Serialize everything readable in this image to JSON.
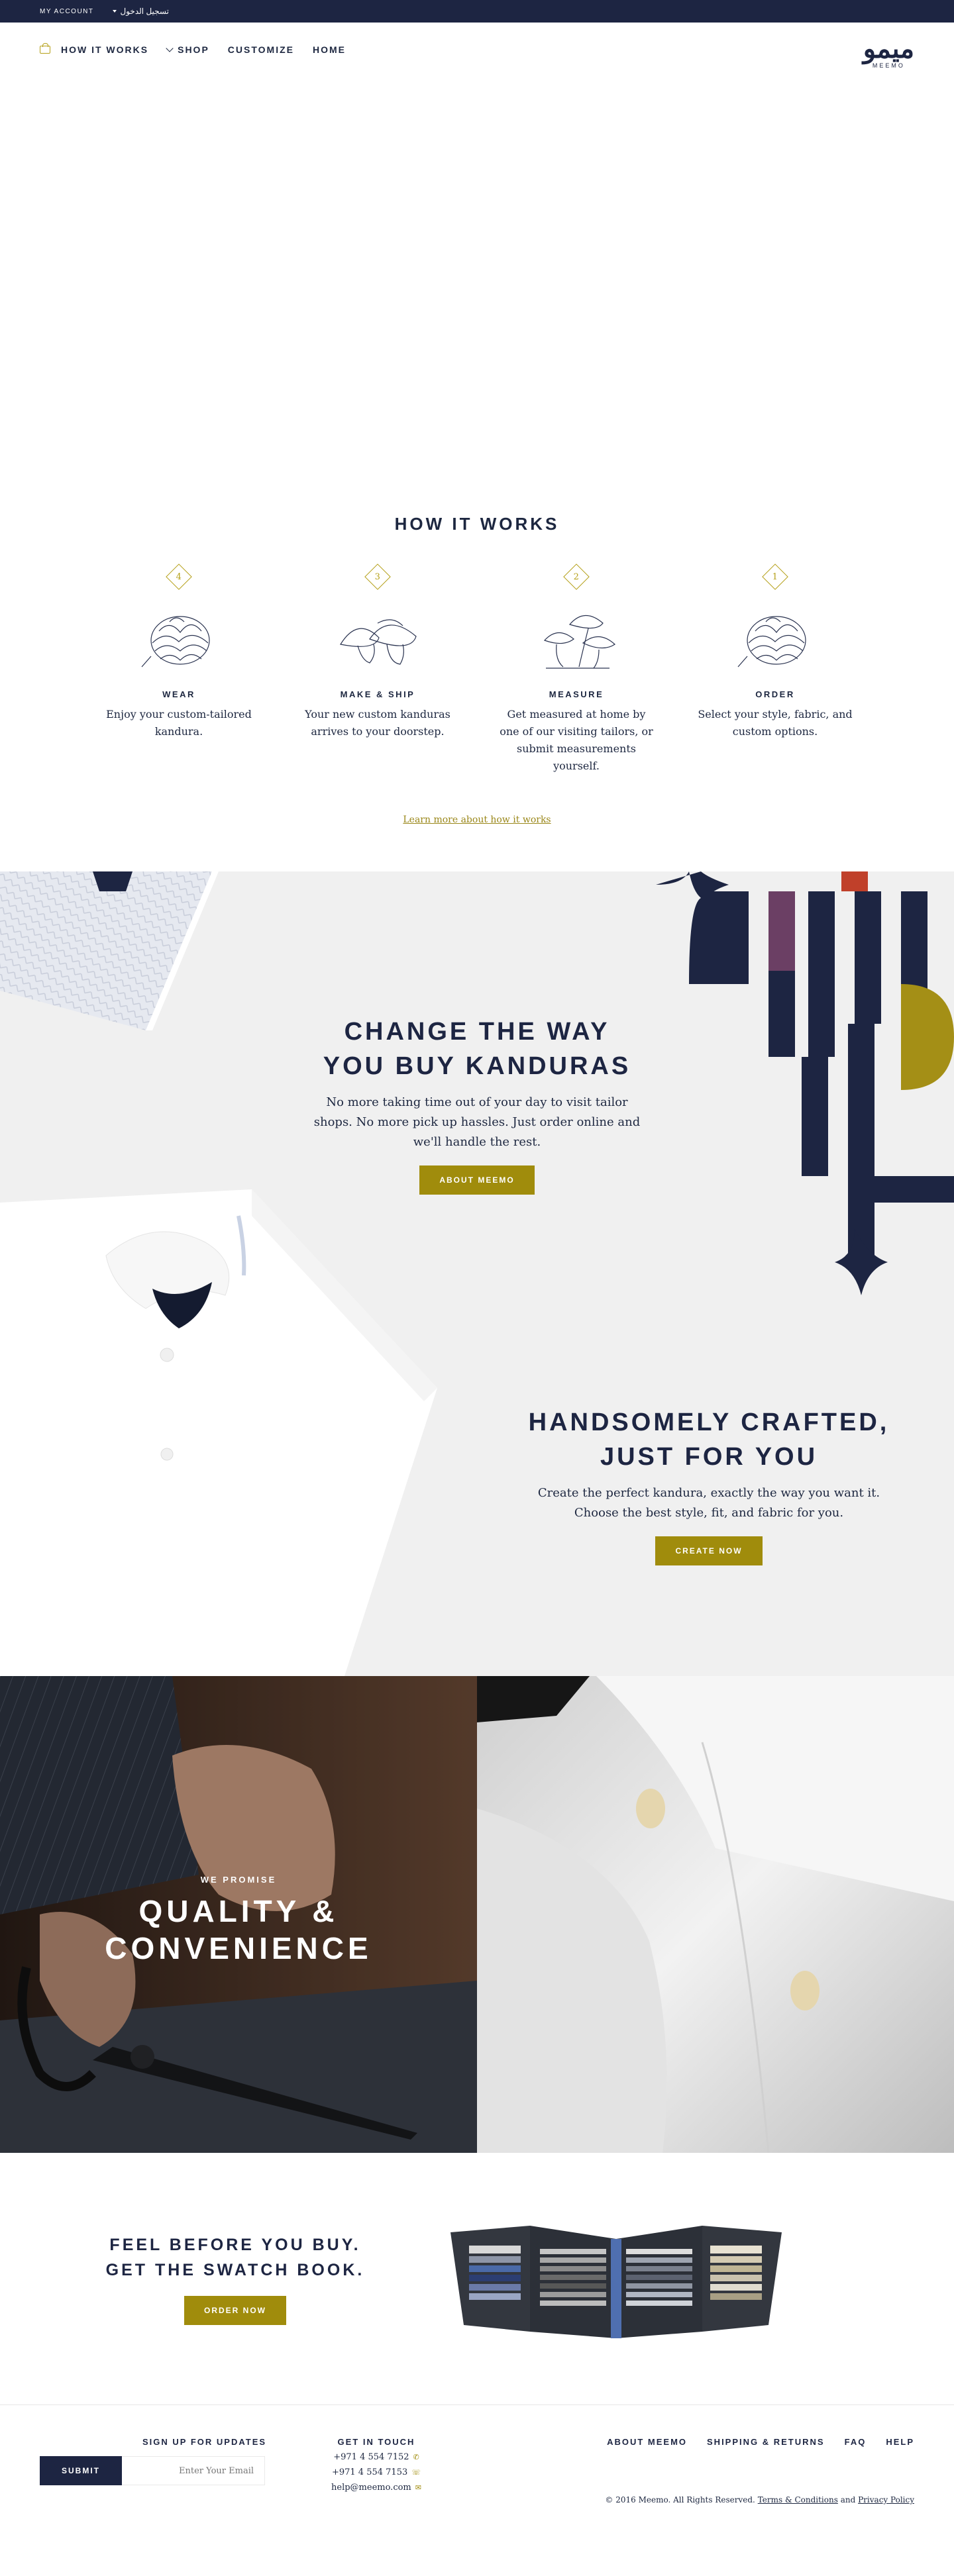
{
  "topbar": {
    "account": "MY ACCOUNT",
    "language": "تسجيل الدخول"
  },
  "nav": {
    "items": [
      "HOW IT WORKS",
      "SHOP",
      "CUSTOMIZE",
      "HOME"
    ],
    "logo_mark": "ميمو",
    "logo_text": "MEEMO"
  },
  "how_it_works": {
    "title": "HOW IT WORKS",
    "steps": [
      {
        "num": "4",
        "title": "WEAR",
        "desc": "Enjoy your custom-tailored kandura.",
        "icon": "artichoke-icon"
      },
      {
        "num": "3",
        "title": "MAKE & SHIP",
        "desc": "Your new custom kanduras arrives to your doorstep.",
        "icon": "mushroom-icon"
      },
      {
        "num": "2",
        "title": "MEASURE",
        "desc": "Get measured at home by one of our visiting tailors, or submit measurements yourself.",
        "icon": "mushroom-cluster-icon"
      },
      {
        "num": "1",
        "title": "ORDER",
        "desc": "Select your style, fabric, and custom options.",
        "icon": "artichoke-icon"
      }
    ],
    "link": "Learn more about how it works"
  },
  "change": {
    "heading": "CHANGE THE WAY YOU BUY KANDURAS",
    "body": "No more taking time out of your day to visit tailor shops. No more pick up hassles. Just order online and we'll handle the rest.",
    "button": "ABOUT MEEMO"
  },
  "crafted": {
    "heading": "HANDSOMELY CRAFTED, JUST FOR YOU",
    "body": "Create the perfect kandura, exactly the way you want it. Choose the best style, fit, and fabric for you.",
    "button": "CREATE NOW"
  },
  "promise": {
    "kicker": "WE PROMISE",
    "heading": "QUALITY & CONVENIENCE"
  },
  "swatch": {
    "heading": "FEEL BEFORE YOU BUY. GET THE SWATCH BOOK.",
    "button": "ORDER NOW"
  },
  "footer": {
    "signup_label": "SIGN UP FOR UPDATES",
    "submit": "SUBMIT",
    "email_placeholder": "Enter Your Email",
    "contact_label": "GET IN TOUCH",
    "phone1": "+971 4 554 7152",
    "phone2": "+971 4 554 7153",
    "email": "help@meemo.com",
    "links": [
      "ABOUT MEEMO",
      "SHIPPING & RETURNS",
      "FAQ",
      "HELP"
    ],
    "copyright": "© 2016 Meemo. All Rights Reserved.",
    "terms": "Terms & Conditions",
    "and": "and",
    "privacy": "Privacy Policy"
  },
  "colors": {
    "navy": "#1d2542",
    "gold": "#a08c0c",
    "band": "#f0f0f0"
  }
}
